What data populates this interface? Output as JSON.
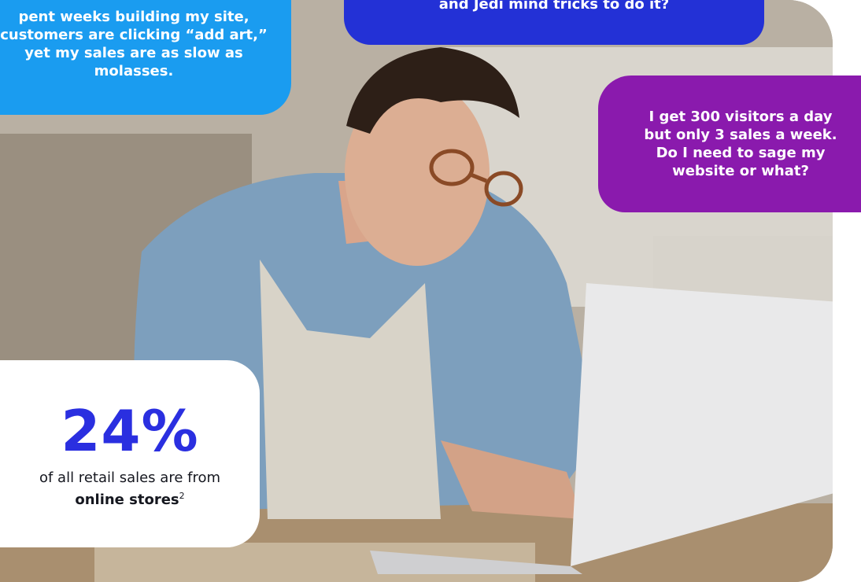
{
  "bubbles": {
    "left": "pent weeks building my site, customers are clicking “add art,” yet my sales are as slow as molasses.",
    "top": "and Jedi mind tricks to do it?",
    "right": "I get 300 visitors a day but only 3 sales a week. Do I need to sage my website or what?"
  },
  "stat": {
    "value": "24%",
    "description": "of all retail sales are from",
    "emphasis": "online stores",
    "footnote": "2"
  },
  "colors": {
    "left_bubble": "#1a9cf0",
    "top_bubble": "#2331d6",
    "right_bubble": "#8a1aad",
    "stat_value": "#2a2fe0"
  }
}
